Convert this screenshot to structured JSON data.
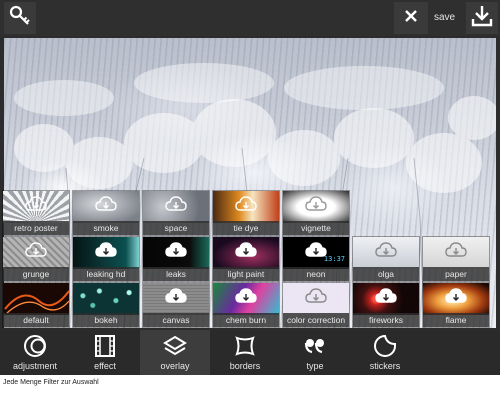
{
  "topbar": {
    "save_label": "save",
    "icons": [
      "key-icon",
      "close-icon",
      "download-icon"
    ]
  },
  "filters": {
    "row1": [
      {
        "label": "retro poster",
        "theme": "#cfd2d8"
      },
      {
        "label": "smoke",
        "theme": "#9aa0a8"
      },
      {
        "label": "space",
        "theme": "#9da2aa"
      },
      {
        "label": "tie dye",
        "theme": "#d98a2a"
      },
      {
        "label": "vignette",
        "theme": "#f2f2f2"
      }
    ],
    "row2": [
      {
        "label": "grunge",
        "theme": "#a8a8a8"
      },
      {
        "label": "leaking hd",
        "theme": "#0b2a2a"
      },
      {
        "label": "leaks",
        "theme": "#0a0a0a"
      },
      {
        "label": "light paint",
        "theme": "#1a1020"
      },
      {
        "label": "neon",
        "theme": "#000000"
      },
      {
        "label": "olga",
        "theme": "#d6dae3"
      },
      {
        "label": "paper",
        "theme": "#e2e2e2"
      }
    ],
    "row3": [
      {
        "label": "default",
        "theme": "#3a1206"
      },
      {
        "label": "bokeh",
        "theme": "#0e3b3a"
      },
      {
        "label": "canvas",
        "theme": "#8a8a8a"
      },
      {
        "label": "chem burn",
        "theme": "#2a6b3a"
      },
      {
        "label": "color correction",
        "theme": "#e6e0f0"
      },
      {
        "label": "fireworks",
        "theme": "#1a0a0a"
      },
      {
        "label": "flame",
        "theme": "#e8a040"
      }
    ],
    "neon_text": "13:37"
  },
  "toolbar": {
    "items": [
      {
        "label": "adjustment",
        "icon": "adjustment-icon"
      },
      {
        "label": "effect",
        "icon": "film-icon"
      },
      {
        "label": "overlay",
        "icon": "layers-icon"
      },
      {
        "label": "borders",
        "icon": "border-frame-icon"
      },
      {
        "label": "type",
        "icon": "quote-icon"
      },
      {
        "label": "stickers",
        "icon": "sticker-icon"
      }
    ],
    "active": "overlay"
  },
  "caption": "Jede Menge Filter zur Auswahl",
  "colors": {
    "toolbar_bg": "#2a2a2a",
    "active_tool_bg": "#3d3d3d",
    "text": "#e6e6e6"
  }
}
